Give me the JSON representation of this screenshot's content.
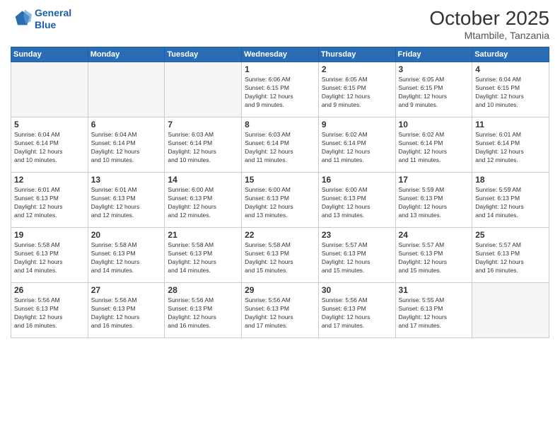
{
  "logo": {
    "line1": "General",
    "line2": "Blue"
  },
  "header": {
    "month": "October 2025",
    "location": "Mtambile, Tanzania"
  },
  "weekdays": [
    "Sunday",
    "Monday",
    "Tuesday",
    "Wednesday",
    "Thursday",
    "Friday",
    "Saturday"
  ],
  "weeks": [
    [
      {
        "day": null,
        "info": null
      },
      {
        "day": null,
        "info": null
      },
      {
        "day": null,
        "info": null
      },
      {
        "day": "1",
        "info": "Sunrise: 6:06 AM\nSunset: 6:15 PM\nDaylight: 12 hours\nand 9 minutes."
      },
      {
        "day": "2",
        "info": "Sunrise: 6:05 AM\nSunset: 6:15 PM\nDaylight: 12 hours\nand 9 minutes."
      },
      {
        "day": "3",
        "info": "Sunrise: 6:05 AM\nSunset: 6:15 PM\nDaylight: 12 hours\nand 9 minutes."
      },
      {
        "day": "4",
        "info": "Sunrise: 6:04 AM\nSunset: 6:15 PM\nDaylight: 12 hours\nand 10 minutes."
      }
    ],
    [
      {
        "day": "5",
        "info": "Sunrise: 6:04 AM\nSunset: 6:14 PM\nDaylight: 12 hours\nand 10 minutes."
      },
      {
        "day": "6",
        "info": "Sunrise: 6:04 AM\nSunset: 6:14 PM\nDaylight: 12 hours\nand 10 minutes."
      },
      {
        "day": "7",
        "info": "Sunrise: 6:03 AM\nSunset: 6:14 PM\nDaylight: 12 hours\nand 10 minutes."
      },
      {
        "day": "8",
        "info": "Sunrise: 6:03 AM\nSunset: 6:14 PM\nDaylight: 12 hours\nand 11 minutes."
      },
      {
        "day": "9",
        "info": "Sunrise: 6:02 AM\nSunset: 6:14 PM\nDaylight: 12 hours\nand 11 minutes."
      },
      {
        "day": "10",
        "info": "Sunrise: 6:02 AM\nSunset: 6:14 PM\nDaylight: 12 hours\nand 11 minutes."
      },
      {
        "day": "11",
        "info": "Sunrise: 6:01 AM\nSunset: 6:14 PM\nDaylight: 12 hours\nand 12 minutes."
      }
    ],
    [
      {
        "day": "12",
        "info": "Sunrise: 6:01 AM\nSunset: 6:13 PM\nDaylight: 12 hours\nand 12 minutes."
      },
      {
        "day": "13",
        "info": "Sunrise: 6:01 AM\nSunset: 6:13 PM\nDaylight: 12 hours\nand 12 minutes."
      },
      {
        "day": "14",
        "info": "Sunrise: 6:00 AM\nSunset: 6:13 PM\nDaylight: 12 hours\nand 12 minutes."
      },
      {
        "day": "15",
        "info": "Sunrise: 6:00 AM\nSunset: 6:13 PM\nDaylight: 12 hours\nand 13 minutes."
      },
      {
        "day": "16",
        "info": "Sunrise: 6:00 AM\nSunset: 6:13 PM\nDaylight: 12 hours\nand 13 minutes."
      },
      {
        "day": "17",
        "info": "Sunrise: 5:59 AM\nSunset: 6:13 PM\nDaylight: 12 hours\nand 13 minutes."
      },
      {
        "day": "18",
        "info": "Sunrise: 5:59 AM\nSunset: 6:13 PM\nDaylight: 12 hours\nand 14 minutes."
      }
    ],
    [
      {
        "day": "19",
        "info": "Sunrise: 5:58 AM\nSunset: 6:13 PM\nDaylight: 12 hours\nand 14 minutes."
      },
      {
        "day": "20",
        "info": "Sunrise: 5:58 AM\nSunset: 6:13 PM\nDaylight: 12 hours\nand 14 minutes."
      },
      {
        "day": "21",
        "info": "Sunrise: 5:58 AM\nSunset: 6:13 PM\nDaylight: 12 hours\nand 14 minutes."
      },
      {
        "day": "22",
        "info": "Sunrise: 5:58 AM\nSunset: 6:13 PM\nDaylight: 12 hours\nand 15 minutes."
      },
      {
        "day": "23",
        "info": "Sunrise: 5:57 AM\nSunset: 6:13 PM\nDaylight: 12 hours\nand 15 minutes."
      },
      {
        "day": "24",
        "info": "Sunrise: 5:57 AM\nSunset: 6:13 PM\nDaylight: 12 hours\nand 15 minutes."
      },
      {
        "day": "25",
        "info": "Sunrise: 5:57 AM\nSunset: 6:13 PM\nDaylight: 12 hours\nand 16 minutes."
      }
    ],
    [
      {
        "day": "26",
        "info": "Sunrise: 5:56 AM\nSunset: 6:13 PM\nDaylight: 12 hours\nand 16 minutes."
      },
      {
        "day": "27",
        "info": "Sunrise: 5:56 AM\nSunset: 6:13 PM\nDaylight: 12 hours\nand 16 minutes."
      },
      {
        "day": "28",
        "info": "Sunrise: 5:56 AM\nSunset: 6:13 PM\nDaylight: 12 hours\nand 16 minutes."
      },
      {
        "day": "29",
        "info": "Sunrise: 5:56 AM\nSunset: 6:13 PM\nDaylight: 12 hours\nand 17 minutes."
      },
      {
        "day": "30",
        "info": "Sunrise: 5:56 AM\nSunset: 6:13 PM\nDaylight: 12 hours\nand 17 minutes."
      },
      {
        "day": "31",
        "info": "Sunrise: 5:55 AM\nSunset: 6:13 PM\nDaylight: 12 hours\nand 17 minutes."
      },
      {
        "day": null,
        "info": null
      }
    ]
  ]
}
